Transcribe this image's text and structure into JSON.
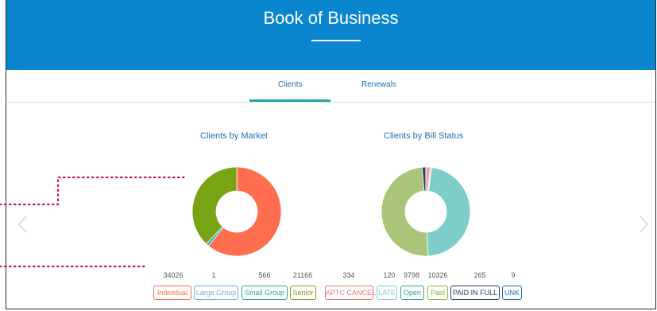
{
  "header": {
    "title": "Book of Business"
  },
  "tabs": [
    {
      "label": "Clients",
      "active": true
    },
    {
      "label": "Renewals",
      "active": false
    }
  ],
  "charts": {
    "market": {
      "title": "Clients by Market"
    },
    "bill": {
      "title": "Clients by Bill Status"
    }
  },
  "market_stats": [
    {
      "count": "34026",
      "label": "Individual",
      "color": "#f4704f"
    },
    {
      "count": "1",
      "label": "Large Group",
      "color": "#6fb1d8"
    },
    {
      "count": "566",
      "label": "Small Group",
      "color": "#23a4a2"
    },
    {
      "count": "21166",
      "label": "Senior",
      "color": "#7aa315"
    }
  ],
  "bill_stats": [
    {
      "count": "334",
      "label": "APTC CANCEL",
      "color": "#f0766a"
    },
    {
      "count": "120",
      "label": "LATE",
      "color": "#7fcfd4"
    },
    {
      "count": "9798",
      "label": "Open",
      "color": "#23a4a2"
    },
    {
      "count": "10326",
      "label": "Paid",
      "color": "#8fb33a"
    },
    {
      "count": "265",
      "label": "PAID IN FULL",
      "color": "#2a3c6b"
    },
    {
      "count": "9",
      "label": "UNK",
      "color": "#1f6fb0"
    }
  ],
  "chart_data": [
    {
      "type": "pie",
      "title": "Clients by Market",
      "categories": [
        "Individual",
        "Large Group",
        "Small Group",
        "Senior"
      ],
      "values": [
        34026,
        1,
        566,
        21166
      ],
      "colors": [
        "#ff6e4f",
        "#5aa9d6",
        "#2bb0ad",
        "#78a312"
      ]
    },
    {
      "type": "pie",
      "title": "Clients by Bill Status",
      "categories": [
        "APTC CANCEL",
        "LATE",
        "Open",
        "Paid",
        "PAID IN FULL",
        "UNK"
      ],
      "values": [
        334,
        120,
        9798,
        10326,
        265,
        9
      ],
      "colors": [
        "#f4a3a0",
        "#b9e3e6",
        "#7fcdc8",
        "#a8c57a",
        "#2a3c6b",
        "#1f6fb0"
      ]
    }
  ],
  "icons": {
    "prev": "chevron-left-icon",
    "next": "chevron-right-icon"
  }
}
